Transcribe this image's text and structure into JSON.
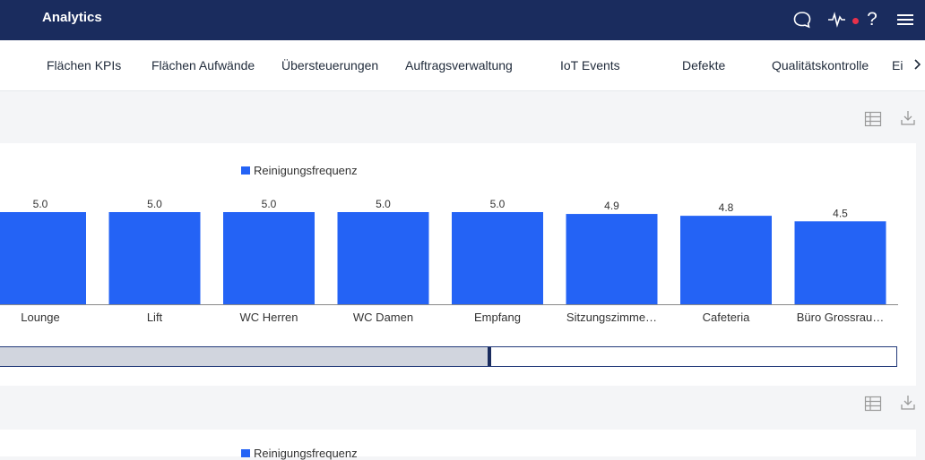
{
  "header": {
    "title": "Analytics",
    "icons": [
      "chat-icon",
      "activity-icon",
      "help-icon",
      "menu-icon"
    ],
    "notification_color": "#e8314a"
  },
  "tabs": [
    {
      "label": "Flächen KPIs"
    },
    {
      "label": "Flächen Aufwände"
    },
    {
      "label": "Übersteuerungen"
    },
    {
      "label": "Auftragsverwaltung"
    },
    {
      "label": "IoT Events"
    },
    {
      "label": "Defekte"
    },
    {
      "label": "Qualitätskontrolle"
    },
    {
      "label": "Ei"
    }
  ],
  "colors": {
    "bar": "#2463f5",
    "header": "#1a2c5e",
    "accent": "#233a7a"
  },
  "chart_data": {
    "type": "bar",
    "categories": [
      "Lounge",
      "Lift",
      "WC Herren",
      "WC Damen",
      "Empfang",
      "Sitzungszimme…",
      "Cafeteria",
      "Büro Grossrau…"
    ],
    "series": [
      {
        "name": "Reinigungsfrequenz",
        "values": [
          5.0,
          5.0,
          5.0,
          5.0,
          5.0,
          4.9,
          4.8,
          4.5
        ]
      }
    ],
    "value_labels": [
      "5.0",
      "5.0",
      "5.0",
      "5.0",
      "5.0",
      "4.9",
      "4.8",
      "4.5"
    ],
    "legend": "top-center",
    "ylim": [
      0,
      5.0
    ],
    "grid": false
  },
  "slider": {
    "position": 0.545
  },
  "second_chart": {
    "legend": "Reinigungsfrequenz"
  }
}
